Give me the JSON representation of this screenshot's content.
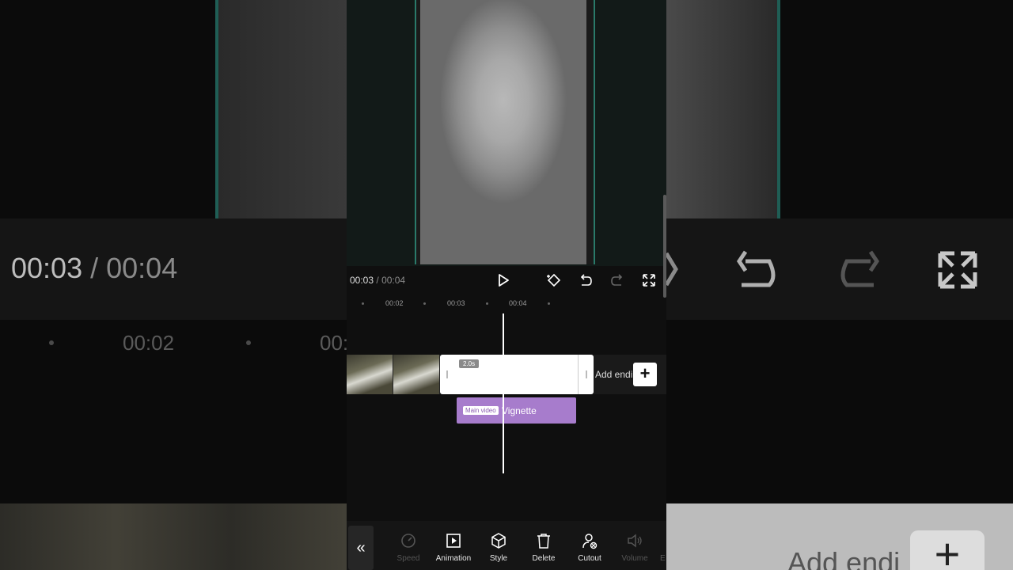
{
  "preview": {
    "time_current": "00:03",
    "time_separator": "/",
    "time_total": "00:04"
  },
  "background_echo": {
    "time_current": "00:03",
    "time_separator": "/",
    "time_total": "00:04",
    "ruler_label": "00:02",
    "ruler_label_cut": "00:",
    "add_ending_label": "Add endi",
    "plus": "+"
  },
  "ruler": {
    "labels": [
      "00:02",
      "00:03",
      "00:04"
    ]
  },
  "timeline": {
    "clip_duration": "2.0s",
    "add_ending_label": "Add endi",
    "add_plus": "+",
    "effect_badge": "Main video",
    "effect_name": "Vignette"
  },
  "toolbar": {
    "back_icon": "«",
    "items": [
      {
        "label": "Speed",
        "icon": "speed-icon",
        "enabled": false
      },
      {
        "label": "Animation",
        "icon": "animation-icon",
        "enabled": true
      },
      {
        "label": "Style",
        "icon": "style-icon",
        "enabled": true
      },
      {
        "label": "Delete",
        "icon": "delete-icon",
        "enabled": true
      },
      {
        "label": "Cutout",
        "icon": "cutout-icon",
        "enabled": true
      },
      {
        "label": "Volume",
        "icon": "volume-icon",
        "enabled": false
      }
    ],
    "overflow_label": "E"
  },
  "colors": {
    "accent_teal": "#2a7a6a",
    "effect_purple": "#a77ccc"
  }
}
